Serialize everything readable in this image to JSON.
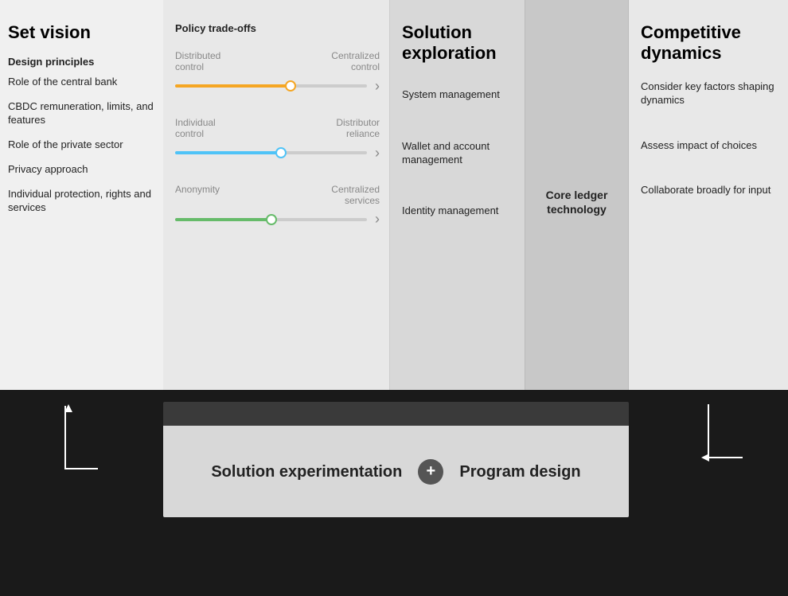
{
  "topBar": {
    "colors": {
      "orange": "#F5A623",
      "gray": "#d0d0d0",
      "darkOrange": "#F5793A"
    }
  },
  "setVision": {
    "title": "Set vision",
    "designPrinciples": "Design principles",
    "items": [
      {
        "id": "central-bank",
        "label": "Role of the central bank"
      },
      {
        "id": "cbdc",
        "label": "CBDC remuneration, limits, and features"
      },
      {
        "id": "private-sector",
        "label": "Role of the private sector"
      },
      {
        "id": "privacy",
        "label": "Privacy approach"
      },
      {
        "id": "protection",
        "label": "Individual protection, rights and services"
      }
    ]
  },
  "policyTradeoffs": {
    "title": "Policy trade-offs",
    "sliders": [
      {
        "id": "distributed",
        "leftLabel": "Distributed control",
        "rightLabel": "Centralized control",
        "color": "orange",
        "position": 60
      },
      {
        "id": "individual",
        "leftLabel": "Individual control",
        "rightLabel": "Distributor reliance",
        "color": "blue",
        "position": 55
      },
      {
        "id": "anonymity",
        "leftLabel": "Anonymity",
        "rightLabel": "Centralized services",
        "color": "green",
        "position": 50
      }
    ]
  },
  "solutionExploration": {
    "title": "Solution exploration",
    "items": [
      {
        "id": "system",
        "label": "System management"
      },
      {
        "id": "wallet",
        "label": "Wallet and account management"
      },
      {
        "id": "identity",
        "label": "Identity management"
      }
    ]
  },
  "coreLedger": {
    "label": "Core ledger technology"
  },
  "competitiveDynamics": {
    "title": "Competitive dynamics",
    "items": [
      {
        "id": "consider",
        "label": "Consider key factors shaping dynamics"
      },
      {
        "id": "assess",
        "label": "Assess impact of choices"
      },
      {
        "id": "collaborate",
        "label": "Collaborate broadly for input"
      }
    ]
  },
  "bottom": {
    "leftTitle": "Solution experimentation",
    "plus": "+",
    "rightTitle": "Program design"
  }
}
